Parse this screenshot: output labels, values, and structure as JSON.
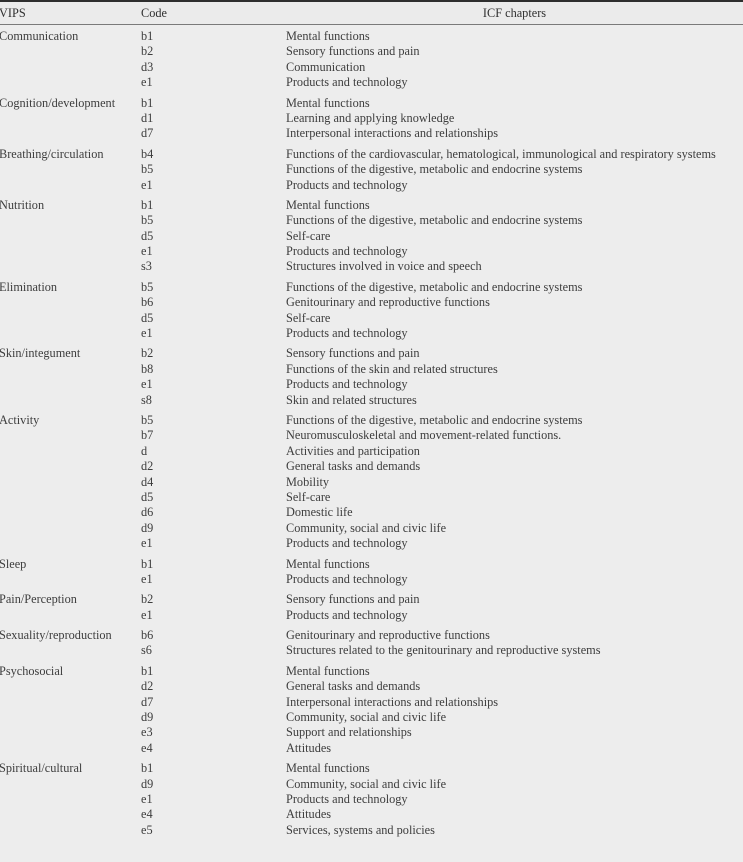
{
  "table": {
    "columns": [
      "VIPS",
      "Code",
      "ICF chapters"
    ],
    "groups": [
      {
        "vips": "Communication",
        "rows": [
          {
            "code": "b1",
            "icf": "Mental functions"
          },
          {
            "code": "b2",
            "icf": "Sensory functions and pain"
          },
          {
            "code": "d3",
            "icf": "Communication"
          },
          {
            "code": "e1",
            "icf": "Products and technology"
          }
        ]
      },
      {
        "vips": "Cognition/development",
        "rows": [
          {
            "code": "b1",
            "icf": "Mental functions"
          },
          {
            "code": "d1",
            "icf": "Learning and applying knowledge"
          },
          {
            "code": "d7",
            "icf": "Interpersonal interactions and relationships"
          }
        ]
      },
      {
        "vips": "Breathing/circulation",
        "rows": [
          {
            "code": "b4",
            "icf": "Functions of the cardiovascular, hematological, immunological and respiratory systems"
          },
          {
            "code": "b5",
            "icf": "Functions of the digestive, metabolic and endocrine systems"
          },
          {
            "code": "e1",
            "icf": "Products and technology"
          }
        ]
      },
      {
        "vips": "Nutrition",
        "rows": [
          {
            "code": "b1",
            "icf": "Mental functions"
          },
          {
            "code": "b5",
            "icf": "Functions of the digestive, metabolic and endocrine systems"
          },
          {
            "code": "d5",
            "icf": "Self-care"
          },
          {
            "code": "e1",
            "icf": "Products and technology"
          },
          {
            "code": "s3",
            "icf": "Structures involved in voice and speech"
          }
        ]
      },
      {
        "vips": "Elimination",
        "rows": [
          {
            "code": "b5",
            "icf": "Functions of the digestive, metabolic and endocrine systems"
          },
          {
            "code": "b6",
            "icf": "Genitourinary and reproductive functions"
          },
          {
            "code": "d5",
            "icf": "Self-care"
          },
          {
            "code": "e1",
            "icf": "Products and technology"
          }
        ]
      },
      {
        "vips": "Skin/integument",
        "rows": [
          {
            "code": "b2",
            "icf": "Sensory functions and pain"
          },
          {
            "code": "b8",
            "icf": "Functions of the skin and related structures"
          },
          {
            "code": "e1",
            "icf": "Products and technology"
          },
          {
            "code": "s8",
            "icf": "Skin and related structures"
          }
        ]
      },
      {
        "vips": "Activity",
        "rows": [
          {
            "code": "b5",
            "icf": "Functions of the digestive, metabolic and endocrine systems"
          },
          {
            "code": "b7",
            "icf": "Neuromusculoskeletal and movement-related functions."
          },
          {
            "code": "d",
            "icf": "Activities and participation"
          },
          {
            "code": "d2",
            "icf": "General tasks and demands"
          },
          {
            "code": "d4",
            "icf": "Mobility"
          },
          {
            "code": "d5",
            "icf": "Self-care"
          },
          {
            "code": "d6",
            "icf": "Domestic life"
          },
          {
            "code": "d9",
            "icf": "Community, social and civic life"
          },
          {
            "code": "e1",
            "icf": "Products and technology"
          }
        ]
      },
      {
        "vips": "Sleep",
        "rows": [
          {
            "code": "b1",
            "icf": "Mental functions"
          },
          {
            "code": "e1",
            "icf": "Products and technology"
          }
        ]
      },
      {
        "vips": "Pain/Perception",
        "rows": [
          {
            "code": "b2",
            "icf": "Sensory functions and pain"
          },
          {
            "code": "e1",
            "icf": "Products and technology"
          }
        ]
      },
      {
        "vips": "Sexuality/reproduction",
        "rows": [
          {
            "code": "b6",
            "icf": "Genitourinary and reproductive functions"
          },
          {
            "code": "s6",
            "icf": "Structures related to the genitourinary and reproductive systems"
          }
        ]
      },
      {
        "vips": "Psychosocial",
        "rows": [
          {
            "code": "b1",
            "icf": "Mental functions"
          },
          {
            "code": "d2",
            "icf": "General tasks and demands"
          },
          {
            "code": "d7",
            "icf": "Interpersonal interactions and relationships"
          },
          {
            "code": "d9",
            "icf": "Community, social and civic life"
          },
          {
            "code": "e3",
            "icf": "Support and relationships"
          },
          {
            "code": "e4",
            "icf": "Attitudes"
          }
        ]
      },
      {
        "vips": "Spiritual/cultural",
        "rows": [
          {
            "code": "b1",
            "icf": "Mental functions"
          },
          {
            "code": "d9",
            "icf": "Community, social and civic life"
          },
          {
            "code": "e1",
            "icf": "Products and technology"
          },
          {
            "code": "e4",
            "icf": "Attitudes"
          },
          {
            "code": "e5",
            "icf": "Services, systems and policies"
          }
        ]
      }
    ]
  }
}
